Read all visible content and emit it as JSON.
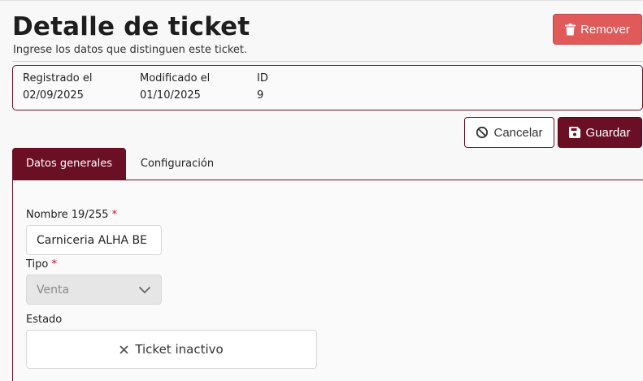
{
  "header": {
    "title": "Detalle de ticket",
    "subtitle": "Ingrese los datos que distinguen este ticket.",
    "remove_label": "Remover"
  },
  "meta": {
    "registered": {
      "label": "Registrado el",
      "value": "02/09/2025"
    },
    "modified": {
      "label": "Modificado el",
      "value": "01/10/2025"
    },
    "id": {
      "label": "ID",
      "value": "9"
    }
  },
  "actions": {
    "cancel_label": "Cancelar",
    "save_label": "Guardar"
  },
  "tabs": [
    {
      "label": "Datos generales",
      "active": true
    },
    {
      "label": "Configuración",
      "active": false
    }
  ],
  "form": {
    "name": {
      "label": "Nombre 19/255",
      "required_mark": "*",
      "value": "Carniceria ALHA BE"
    },
    "type": {
      "label": "Tipo",
      "required_mark": "*",
      "value": "Venta"
    },
    "status": {
      "label": "Estado",
      "value": "Ticket inactivo"
    }
  },
  "icons": {
    "remove": "trash-icon",
    "cancel": "ban-icon",
    "save": "floppy-disk-icon",
    "select": "chevron-down-icon",
    "status": "close-icon"
  },
  "colors": {
    "primary": "#6b0f24",
    "danger": "#e05a5a",
    "required": "#c8102e"
  }
}
